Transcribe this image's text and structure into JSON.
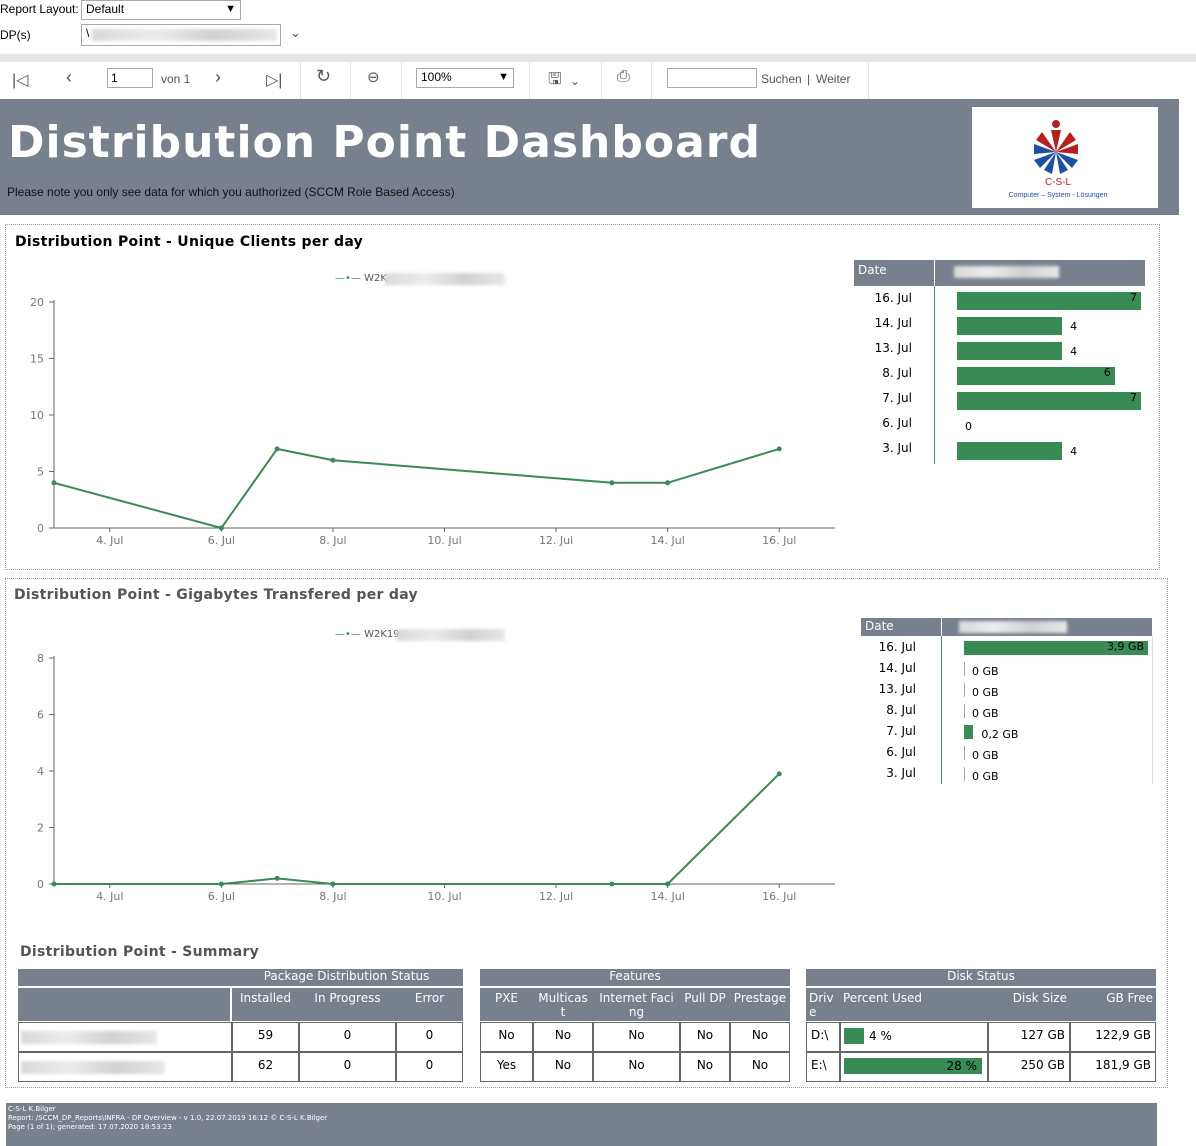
{
  "params": {
    "report_layout_label": "Report Layout:",
    "report_layout_value": "Default",
    "dps_label": "DP(s)",
    "dps_value": "\\"
  },
  "toolbar": {
    "page_value": "1",
    "page_of": "von 1",
    "zoom": "100%",
    "search_label": "Suchen",
    "next_label": "Weiter",
    "search_sep": "|"
  },
  "banner": {
    "title": "Distribution Point Dashboard",
    "note": "Please note you only see data for which you authorized (SCCM Role Based Access)",
    "logo_text": "C-S-L",
    "logo_subtitle": "Computer – System - Lösungen"
  },
  "section1": {
    "title": "Distribution Point  - Unique Clients per day",
    "legend_prefix": "W2K",
    "table_header_date": "Date"
  },
  "section2": {
    "title": "Distribution Point  - Gigabytes Transfered per day",
    "legend_prefix": "W2K19",
    "table_header_date": "Date"
  },
  "chart_data": [
    {
      "type": "line",
      "title": "Distribution Point  - Unique Clients per day",
      "x": [
        "3. Jul",
        "6. Jul",
        "7. Jul",
        "8. Jul",
        "13. Jul",
        "14. Jul",
        "16. Jul"
      ],
      "series": [
        {
          "values": [
            4,
            0,
            7,
            6,
            4,
            4,
            7
          ]
        }
      ],
      "x_ticks": [
        "4. Jul",
        "6. Jul",
        "8. Jul",
        "10. Jul",
        "12. Jul",
        "14. Jul",
        "16. Jul"
      ],
      "y_ticks": [
        "0",
        "5",
        "10",
        "15",
        "20"
      ],
      "ylim": [
        0,
        20
      ]
    },
    {
      "type": "bar",
      "categories": [
        "16. Jul",
        "14. Jul",
        "13. Jul",
        "8. Jul",
        "7. Jul",
        "6. Jul",
        "3. Jul"
      ],
      "values": [
        7,
        4,
        4,
        6,
        7,
        0,
        4
      ],
      "labels": [
        "7",
        "4",
        "4",
        "6",
        "7",
        "0",
        "4"
      ]
    },
    {
      "type": "line",
      "title": "Distribution Point  - Gigabytes Transfered per day",
      "x": [
        "3. Jul",
        "6. Jul",
        "7. Jul",
        "8. Jul",
        "13. Jul",
        "14. Jul",
        "16. Jul"
      ],
      "series": [
        {
          "values": [
            0,
            0,
            0.2,
            0,
            0,
            0,
            3.9
          ]
        }
      ],
      "x_ticks": [
        "4. Jul",
        "6. Jul",
        "8. Jul",
        "10. Jul",
        "12. Jul",
        "14. Jul",
        "16. Jul"
      ],
      "y_ticks": [
        "0",
        "2",
        "4",
        "6",
        "8"
      ],
      "ylim": [
        0,
        8
      ]
    },
    {
      "type": "bar",
      "categories": [
        "16. Jul",
        "14. Jul",
        "13. Jul",
        "8. Jul",
        "7. Jul",
        "6. Jul",
        "3. Jul"
      ],
      "values": [
        3.9,
        0,
        0,
        0,
        0.2,
        0,
        0
      ],
      "labels": [
        "3,9 GB",
        "0 GB",
        "0 GB",
        "0 GB",
        "0,2 GB",
        "0 GB",
        "0 GB"
      ]
    }
  ],
  "summary": {
    "title": "Distribution Point  - Summary",
    "group_headers": [
      "Package Distribution Status",
      "Features",
      "Disk Status"
    ],
    "col_headers": [
      "Installed",
      "In Progress",
      "Error",
      "PXE",
      "Multicast",
      "Internet Facing",
      "Pull DP",
      "Prestage",
      "Drive",
      "Percent Used",
      "Disk Size",
      "GB Free"
    ],
    "rows": [
      {
        "installed": "59",
        "in_progress": "0",
        "error": "0",
        "pxe": "No",
        "multicast": "No",
        "internet": "No",
        "pull": "No",
        "prestage": "No",
        "drive": "D:\\",
        "percent": "4 %",
        "percent_value": 4,
        "size": "127 GB",
        "free": "122,9 GB"
      },
      {
        "installed": "62",
        "in_progress": "0",
        "error": "0",
        "pxe": "Yes",
        "multicast": "No",
        "internet": "No",
        "pull": "No",
        "prestage": "No",
        "drive": "E:\\",
        "percent": "28 %",
        "percent_value": 28,
        "size": "250 GB",
        "free": "181,9 GB"
      }
    ]
  },
  "footer": {
    "line1": "C-S-L K.Bilger",
    "line2": "Report: /SCCM_DP_Reports\\INFRA - DP Overview - v 1.0, 22.07.2019 16:12 © C-S-L K.Bilger",
    "line3": "Page (1 of 1); generated: 17.07.2020 18:53:23"
  },
  "colors": {
    "header": "#78808e",
    "bar": "#3a8a55",
    "line": "#3a8a55"
  }
}
